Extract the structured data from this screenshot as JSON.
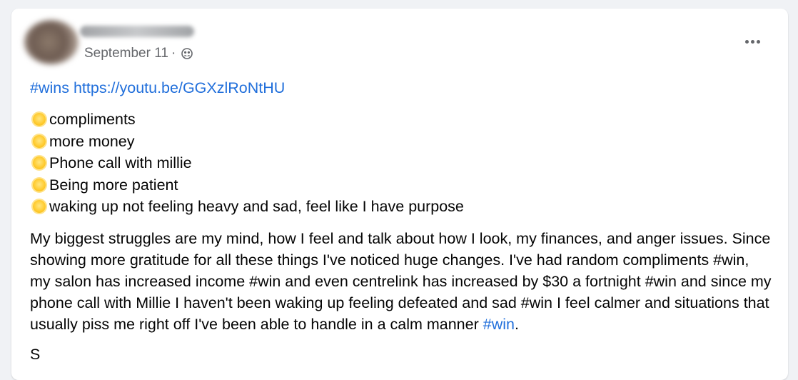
{
  "post": {
    "date": "September 11",
    "separator": "·",
    "privacy_icon": "friends-icon",
    "more_icon": "ellipsis-icon",
    "hashtag": "#wins",
    "link": "https://youtu.be/GGXzlRoNtHU",
    "list": [
      "compliments",
      "more money",
      "Phone call with millie",
      "Being more patient",
      "waking up not feeling heavy and sad, feel like I have purpose"
    ],
    "body_text": "My biggest struggles are my mind, how I feel and talk about how I look, my finances, and anger issues. Since showing more gratitude for all these things I've noticed huge changes. I've had random compliments #win, my salon has increased income #win  and even centrelink has increased by $30 a fortnight #win  and since my phone call with Millie I haven't been waking up feeling defeated and sad #win I feel calmer and situations that usually piss me right off I've been able to handle in a calm manner ",
    "body_hashtag": "#win",
    "body_end": ".",
    "cut_text": "S"
  },
  "colors": {
    "link": "#216fdb",
    "meta": "#65676b",
    "background": "#f0f2f5"
  }
}
